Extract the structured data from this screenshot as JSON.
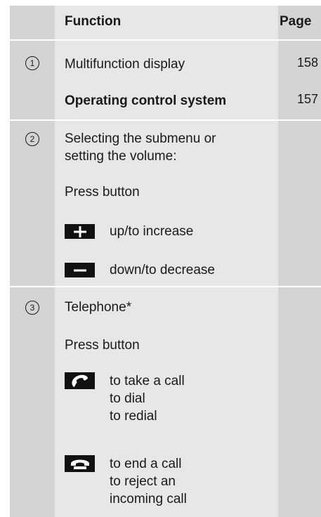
{
  "header": {
    "col1": "",
    "col2": "Function",
    "col3": "Page"
  },
  "row1": {
    "marker": "1",
    "item1_label": "Multifunction display",
    "item1_page": "158",
    "item2_label": "Operating control system",
    "item2_page": "157"
  },
  "row2": {
    "marker": "2",
    "desc_line1": "Selecting the submenu or",
    "desc_line2": "setting the volume:",
    "press": "Press button",
    "plus_label": "up/to increase",
    "minus_label": "down/to decrease",
    "plus_icon": "plus-icon",
    "minus_icon": "minus-icon"
  },
  "row3": {
    "marker": "3",
    "title": "Telephone*",
    "press": "Press button",
    "accept_lines": [
      "to take a call",
      "to dial",
      "to redial"
    ],
    "end_lines": [
      "to end a call",
      "to reject an",
      "incoming call"
    ],
    "accept_icon": "phone-accept-icon",
    "end_icon": "phone-end-icon"
  },
  "colors": {
    "dark_col": "#d4d4d4",
    "light_col": "#e7e7e7"
  }
}
